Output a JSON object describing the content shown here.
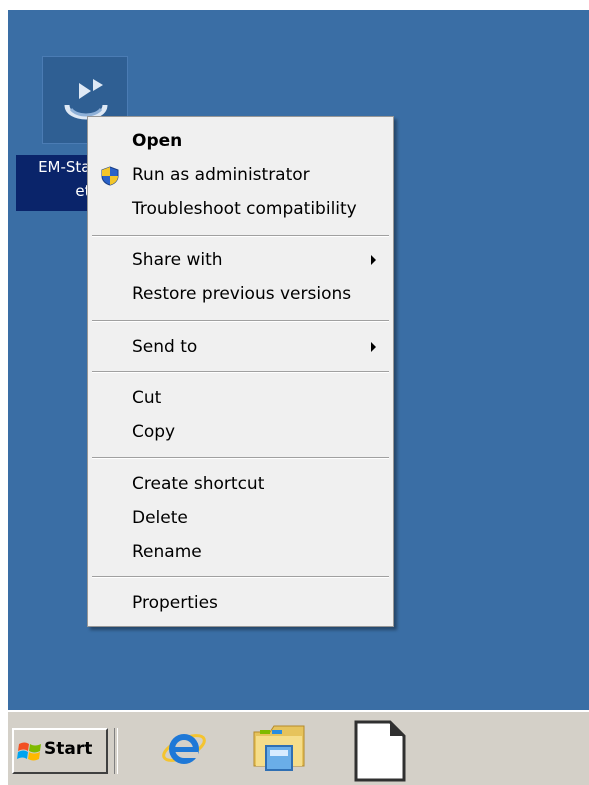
{
  "desktop": {
    "background_color": "#3a6ea5",
    "icon": {
      "name": "setup-app-icon",
      "label_line1": "EM-Stan",
      "label_line2": "etu"
    }
  },
  "context_menu": {
    "items": [
      {
        "label": "Open",
        "bold": true,
        "has_shield": false,
        "has_submenu": false
      },
      {
        "label": "Run as administrator",
        "bold": false,
        "has_shield": true,
        "has_submenu": false
      },
      {
        "label": "Troubleshoot compatibility",
        "bold": false,
        "has_shield": false,
        "has_submenu": false
      },
      {
        "label": "Share with",
        "bold": false,
        "has_shield": false,
        "has_submenu": true
      },
      {
        "label": "Restore previous versions",
        "bold": false,
        "has_shield": false,
        "has_submenu": false
      },
      {
        "label": "Send to",
        "bold": false,
        "has_shield": false,
        "has_submenu": true
      },
      {
        "label": "Cut",
        "bold": false,
        "has_shield": false,
        "has_submenu": false
      },
      {
        "label": "Copy",
        "bold": false,
        "has_shield": false,
        "has_submenu": false
      },
      {
        "label": "Create shortcut",
        "bold": false,
        "has_shield": false,
        "has_submenu": false
      },
      {
        "label": "Delete",
        "bold": false,
        "has_shield": false,
        "has_submenu": false
      },
      {
        "label": "Rename",
        "bold": false,
        "has_shield": false,
        "has_submenu": false
      },
      {
        "label": "Properties",
        "bold": false,
        "has_shield": false,
        "has_submenu": false
      }
    ]
  },
  "taskbar": {
    "start_label": "Start",
    "pinned": [
      {
        "name": "internet-explorer-icon"
      },
      {
        "name": "windows-explorer-icon"
      },
      {
        "name": "blank-document-icon"
      }
    ]
  }
}
